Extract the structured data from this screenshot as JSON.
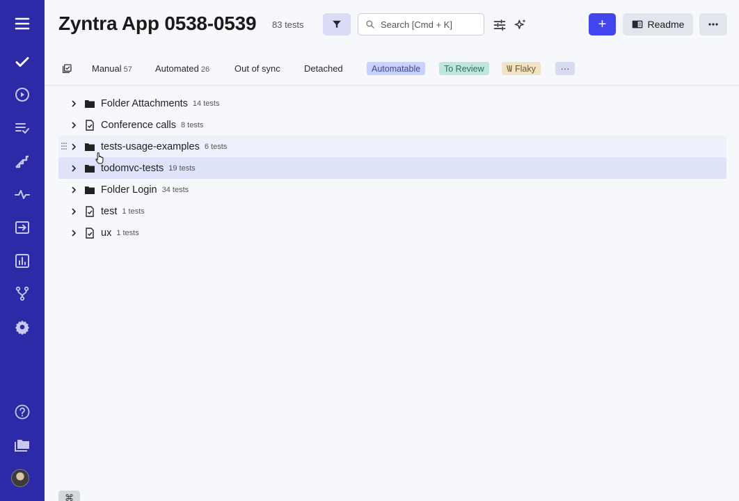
{
  "header": {
    "title": "Zyntra App 0538-0539",
    "test_count": "83 tests",
    "search_placeholder": "Search [Cmd + K]",
    "readme_label": "Readme",
    "add_label": "+"
  },
  "tabs": [
    {
      "label": "Manual",
      "count": "57"
    },
    {
      "label": "Automated",
      "count": "26"
    },
    {
      "label": "Out of sync"
    },
    {
      "label": "Detached"
    }
  ],
  "chips": {
    "automatable": "Automatable",
    "to_review": "To Review",
    "flaky": "Flaky",
    "more": "···"
  },
  "tree": [
    {
      "name": "Folder Attachments",
      "count": "14 tests",
      "icon": "folder-icon"
    },
    {
      "name": "Conference calls",
      "count": "8 tests",
      "icon": "file-check-icon"
    },
    {
      "name": "tests-usage-examples",
      "count": "6 tests",
      "icon": "folder-icon",
      "state": "hover"
    },
    {
      "name": "todomvc-tests",
      "count": "19 tests",
      "icon": "folder-icon",
      "state": "selected"
    },
    {
      "name": "Folder Login",
      "count": "34 tests",
      "icon": "folder-icon"
    },
    {
      "name": "test",
      "count": "1 tests",
      "icon": "file-check-icon"
    },
    {
      "name": "ux",
      "count": "1 tests",
      "icon": "file-check-icon"
    }
  ],
  "shortcut_key": "⌘",
  "sidebar": {
    "icons": [
      "menu-icon",
      "check-icon",
      "play-circle-icon",
      "checklist-icon",
      "steps-icon",
      "pulse-icon",
      "import-icon",
      "analytics-icon",
      "branch-icon",
      "settings-icon",
      "help-icon",
      "folders-icon"
    ]
  },
  "colors": {
    "sidebar": "#2d2aa8",
    "accent": "#4346ec",
    "selected_row": "#dfe3fa"
  }
}
